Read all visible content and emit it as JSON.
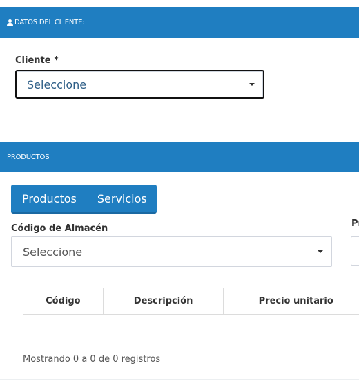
{
  "cliente_section": {
    "header": "DATOS DEL CLIENTE:",
    "icon": "user-icon",
    "cliente_label": "Cliente *",
    "cliente_value": "Seleccione"
  },
  "productos_section": {
    "header": "PRODUCTOS",
    "tabs": [
      {
        "label": "Productos"
      },
      {
        "label": "Servicios"
      }
    ],
    "almacen_label": "Código de Almacén",
    "almacen_value": "Seleccione",
    "cut_label": "Pr",
    "table": {
      "columns": [
        "Código",
        "Descripción",
        "Precio unitario"
      ],
      "rows": []
    },
    "info": "Mostrando 0 a 0 de 0 registros"
  },
  "colors": {
    "primary": "#1f7ec1"
  }
}
